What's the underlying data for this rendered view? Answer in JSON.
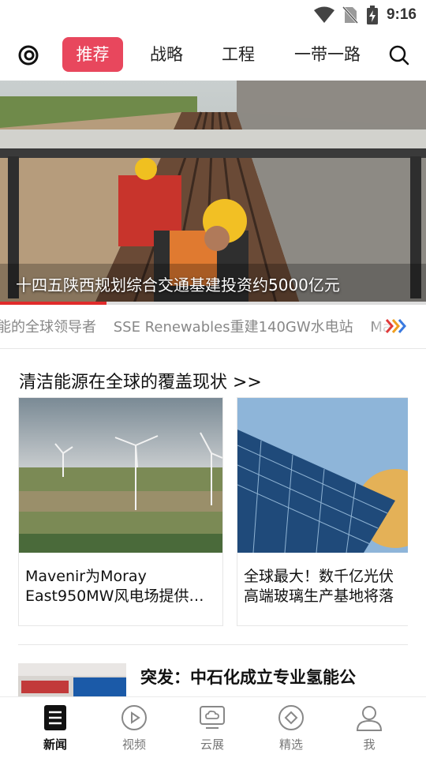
{
  "status_bar": {
    "time": "9:16"
  },
  "top_nav": {
    "tabs": [
      {
        "label": "推荐",
        "active": true
      },
      {
        "label": "战略",
        "active": false
      },
      {
        "label": "工程",
        "active": false
      },
      {
        "label": "一带一路",
        "active": false
      }
    ]
  },
  "hero": {
    "caption": "十四五陕西规划综合交通基建投资约5000亿元",
    "progress": 0.25
  },
  "ticker": {
    "items": [
      "能的全球领导者",
      "SSE Renewables重建140GW水电站",
      "Ma"
    ]
  },
  "section": {
    "title": "清洁能源在全球的覆盖现状 >>",
    "cards": [
      {
        "title": "Mavenir为Moray\nEast950MW风电场提供…"
      },
      {
        "title": "全球最大！数千亿光伏\n高端玻璃生产基地将落"
      }
    ]
  },
  "news": {
    "title": "突发：中石化成立专业氢能公"
  },
  "bottom_nav": {
    "items": [
      {
        "label": "新闻",
        "icon": "news-icon",
        "active": true
      },
      {
        "label": "视频",
        "icon": "play-icon",
        "active": false
      },
      {
        "label": "云展",
        "icon": "cloud-screen-icon",
        "active": false
      },
      {
        "label": "精选",
        "icon": "diamond-icon",
        "active": false
      },
      {
        "label": "我",
        "icon": "user-icon",
        "active": false
      }
    ]
  },
  "colors": {
    "accent": "#e8475d",
    "progress": "#e02b2b"
  }
}
